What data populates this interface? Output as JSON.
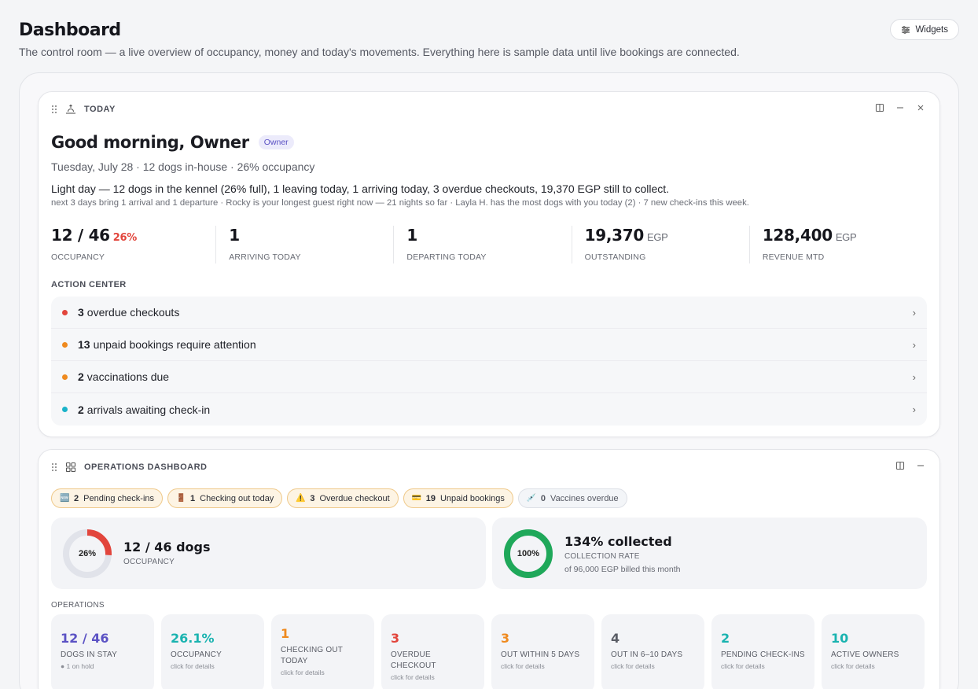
{
  "header": {
    "title": "Dashboard",
    "subtitle": "The control room — a live overview of occupancy, money and today's movements. Everything here is sample data until live bookings are connected.",
    "widgets_label": "Widgets"
  },
  "today": {
    "title": "TODAY",
    "greeting": "Good morning, Owner",
    "role_badge": "Owner",
    "date_line": "Tuesday, July 28 · 12 dogs in-house · 26% occupancy",
    "summary": "Light day — 12 dogs in the kennel (26% full), 1 leaving today, 1 arriving today, 3 overdue checkouts, 19,370 EGP still to collect.",
    "summary_sub": "next 3 days bring 1 arrival and 1 departure · Rocky is your longest guest right now — 21 nights so far · Layla H. has the most dogs with you today (2) · 7 new check-ins this week.",
    "kpis": [
      {
        "value": "12 / 46",
        "accent": "26%",
        "unit": "",
        "label": "OCCUPANCY"
      },
      {
        "value": "1",
        "accent": "",
        "unit": "",
        "label": "ARRIVING TODAY"
      },
      {
        "value": "1",
        "accent": "",
        "unit": "",
        "label": "DEPARTING TODAY"
      },
      {
        "value": "19,370",
        "accent": "",
        "unit": "EGP",
        "label": "OUTSTANDING"
      },
      {
        "value": "128,400",
        "accent": "",
        "unit": "EGP",
        "label": "REVENUE MTD"
      }
    ],
    "action_center_title": "ACTION CENTER",
    "actions": [
      {
        "count": "3",
        "text": "overdue checkouts",
        "color": "#e2453c"
      },
      {
        "count": "13",
        "text": "unpaid bookings require attention",
        "color": "#ef8a1f"
      },
      {
        "count": "2",
        "text": "vaccinations due",
        "color": "#ef8a1f"
      },
      {
        "count": "2",
        "text": "arrivals awaiting check-in",
        "color": "#1ab3c9"
      }
    ],
    "chevron": "›"
  },
  "operations": {
    "title": "OPERATIONS DASHBOARD",
    "chips": [
      {
        "icon": "🆕",
        "count": "2",
        "text": "Pending check-ins",
        "style": "warn"
      },
      {
        "icon": "🚪",
        "count": "1",
        "text": "Checking out today",
        "style": "warn"
      },
      {
        "icon": "⚠️",
        "count": "3",
        "text": "Overdue checkout",
        "style": "warn"
      },
      {
        "icon": "💳",
        "count": "19",
        "text": "Unpaid bookings",
        "style": "warn"
      },
      {
        "icon": "💉",
        "count": "0",
        "text": "Vaccines overdue",
        "style": "muted"
      }
    ],
    "occupancy": {
      "ring_text": "26%",
      "fraction": 0.26,
      "color": "#e2453c",
      "main": "12 / 46 dogs",
      "label": "OCCUPANCY"
    },
    "collection": {
      "ring_text": "100%",
      "fraction": 1.0,
      "color": "#1fa85a",
      "main": "134% collected",
      "label": "COLLECTION RATE",
      "sub": "of 96,000 EGP billed this month"
    },
    "ops_section_title": "OPERATIONS",
    "tiles": [
      {
        "value": "12 / 46",
        "label": "DOGS IN STAY",
        "sub": "● 1 on hold",
        "color": "#5b52c4"
      },
      {
        "value": "26.1%",
        "label": "OCCUPANCY",
        "sub": "click for details",
        "color": "#1ab3b0"
      },
      {
        "value": "1",
        "label": "CHECKING OUT TODAY",
        "sub": "click for details",
        "color": "#ef8a1f"
      },
      {
        "value": "3",
        "label": "OVERDUE CHECKOUT",
        "sub": "click for details",
        "color": "#e2453c"
      },
      {
        "value": "3",
        "label": "OUT WITHIN 5 DAYS",
        "sub": "click for details",
        "color": "#ef8a1f"
      },
      {
        "value": "4",
        "label": "OUT IN 6–10 DAYS",
        "sub": "click for details",
        "color": "#5a5d66"
      },
      {
        "value": "2",
        "label": "PENDING CHECK-INS",
        "sub": "click for details",
        "color": "#1ab3b0"
      },
      {
        "value": "10",
        "label": "ACTIVE OWNERS",
        "sub": "click for details",
        "color": "#1ab3b0"
      }
    ]
  }
}
